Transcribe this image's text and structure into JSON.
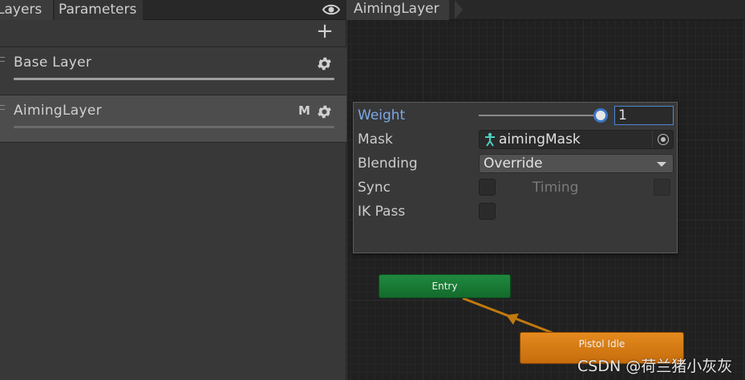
{
  "tabs": {
    "layers": "Layers",
    "parameters": "Parameters"
  },
  "toolbar": {
    "visibility_icon": "eye-icon",
    "add_icon": "plus-icon",
    "add_label": "+"
  },
  "layers": [
    {
      "name": "Base Layer",
      "badge": ""
    },
    {
      "name": "AimingLayer",
      "badge": "M"
    }
  ],
  "breadcrumb": {
    "label": "AimingLayer"
  },
  "settings": {
    "weight_label": "Weight",
    "weight_value": "1",
    "weight_fraction": 1.0,
    "mask_label": "Mask",
    "mask_value": "aimingMask",
    "blending_label": "Blending",
    "blending_value": "Override",
    "sync_label": "Sync",
    "timing_label": "Timing",
    "ik_label": "IK Pass"
  },
  "nodes": {
    "entry": "Entry",
    "idle": "Pistol Idle"
  },
  "watermark": "CSDN @荷兰猪小灰灰",
  "colors": {
    "accent": "#4b89d6",
    "entry_node": "#1f8a3e",
    "state_node": "#e48a1e",
    "transition": "#c1790f"
  }
}
